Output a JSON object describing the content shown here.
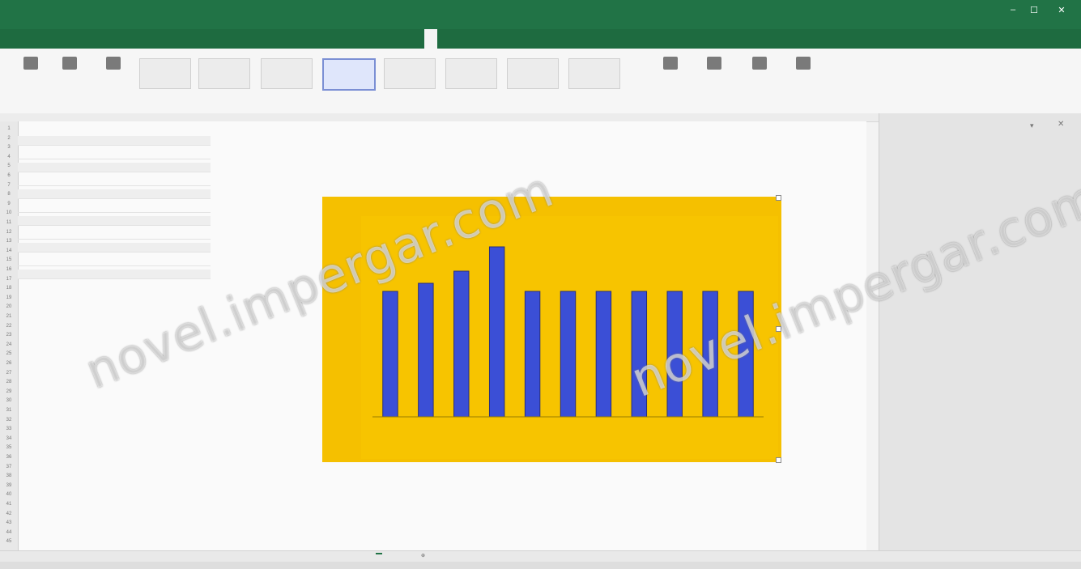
{
  "title_bar": {
    "text_left": "",
    "text_mid1": "",
    "text_mid2": "",
    "text_right": "",
    "min_label": "–",
    "max_label": "☐",
    "close_label": "✕"
  },
  "menu": {
    "items": [
      "",
      "",
      "",
      "",
      "",
      "",
      "",
      "",
      "",
      ""
    ],
    "active_label": "",
    "tell_me": "",
    "share": ""
  },
  "ribbon": {
    "buttons": [
      "",
      "",
      "",
      ""
    ],
    "group_labels": [
      "",
      "",
      ""
    ]
  },
  "table": {
    "headers": [
      "",
      "",
      ""
    ],
    "rows": [
      [
        "",
        "",
        ""
      ],
      [
        "",
        "",
        ""
      ],
      [
        "",
        "",
        ""
      ],
      [
        "",
        "",
        ""
      ],
      [
        "",
        "",
        ""
      ],
      [
        "",
        "",
        ""
      ],
      [
        "",
        "",
        ""
      ],
      [
        "",
        "",
        ""
      ],
      [
        "",
        "",
        ""
      ],
      [
        "",
        "",
        ""
      ],
      [
        "",
        "",
        ""
      ]
    ]
  },
  "chart_data": {
    "type": "bar",
    "title": "",
    "xlabel": "",
    "ylabel": "",
    "categories": [
      "",
      "",
      "",
      "",
      "",
      "",
      "",
      "",
      "",
      "",
      ""
    ],
    "values": [
      0.62,
      0.66,
      0.72,
      0.84,
      0.62,
      0.62,
      0.62,
      0.62,
      0.62,
      0.62,
      0.62
    ],
    "ylim": [
      0,
      1
    ],
    "bar_color": "#3b4fd6",
    "background": "#f5c000",
    "grid": false,
    "legend": "none"
  },
  "pane": {
    "title": "",
    "lines": [
      "",
      "",
      "",
      "",
      "",
      ""
    ]
  },
  "tabs": {
    "items": [
      "",
      "",
      "",
      "",
      "",
      "",
      "",
      ""
    ],
    "active": ""
  },
  "watermark": {
    "text": "novel.impergar.com"
  },
  "colors": {
    "title_bar": "#217346",
    "accent": "#217346"
  }
}
